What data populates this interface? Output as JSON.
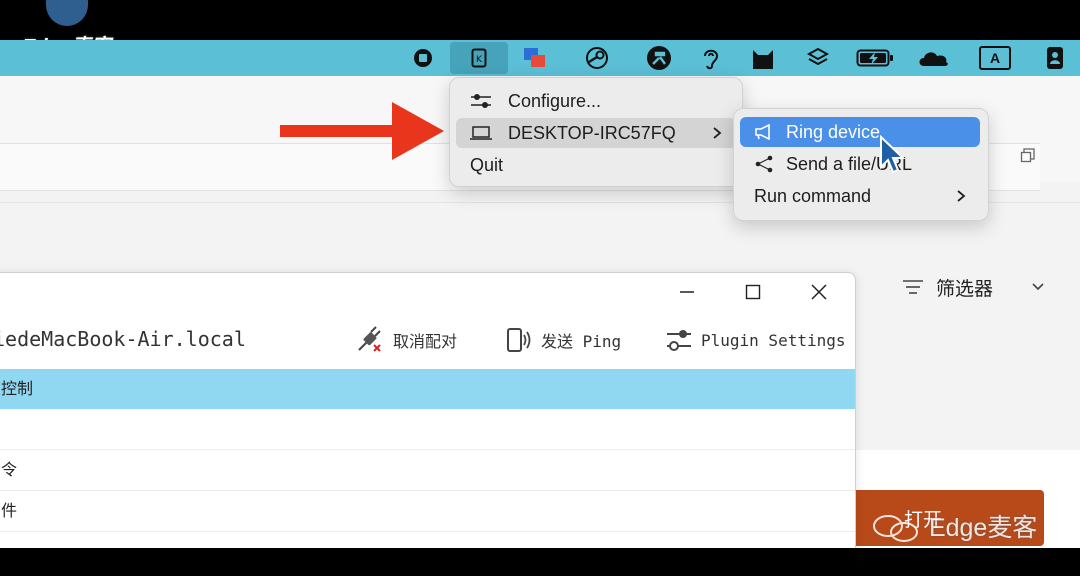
{
  "watermark": {
    "top_text": "Edge麦客",
    "bottom_text": "Edge麦客"
  },
  "menubar": {
    "icons": [
      "stop-icon",
      "kdeconnect-icon",
      "screen-share-icon",
      "steam-icon",
      "tools-icon",
      "ear-icon",
      "cat-icon",
      "layers-icon",
      "battery-charging-icon",
      "onedrive-icon",
      "input-source-icon",
      "contact-card-icon"
    ],
    "input_source": "A",
    "bar_color": "#5bbfd6"
  },
  "tray_menu": {
    "configure": "Configure...",
    "device": "DESKTOP-IRC57FQ",
    "quit": "Quit"
  },
  "submenu": {
    "ring": "Ring device",
    "send": "Send a file/URL",
    "run": "Run command",
    "highlight_color": "#4a90e8"
  },
  "background_app": {
    "filter_label": "筛选器",
    "open_button": "打开",
    "open_color": "#b84a1a"
  },
  "kde_window": {
    "device_name": "iedeMacBook-Air.local",
    "unpair": "取消配对",
    "ping": "发送 Ping",
    "plugin_settings": "Plugin Settings",
    "rows": [
      "控制",
      "",
      "令",
      "件",
      ""
    ]
  }
}
